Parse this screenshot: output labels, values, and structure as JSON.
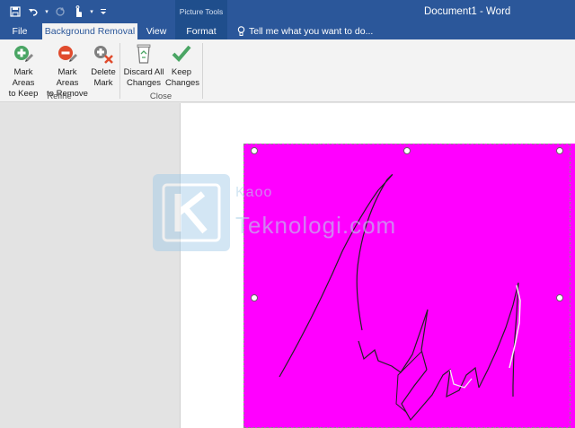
{
  "titlebar": {
    "doc_title": "Document1 - Word",
    "context_group": "Picture Tools"
  },
  "tabs": {
    "file": "File",
    "background_removal": "Background Removal",
    "view": "View",
    "format": "Format",
    "tell_me": "Tell me what you want to do..."
  },
  "ribbon": {
    "mark_keep_line1": "Mark Areas",
    "mark_keep_line2": "to Keep",
    "mark_remove_line1": "Mark Areas",
    "mark_remove_line2": "to Remove",
    "delete_mark_line1": "Delete",
    "delete_mark_line2": "Mark",
    "refine_group": "Refine",
    "discard_line1": "Discard All",
    "discard_line2": "Changes",
    "keep_line1": "Keep",
    "keep_line2": "Changes",
    "close_group": "Close"
  },
  "watermark": {
    "line1": "Kaoo",
    "line2": "Teknologi.com"
  },
  "colors": {
    "title_blue": "#2b579a",
    "removal_magenta": "#ff00ff",
    "keep_green": "#4aa564",
    "remove_red": "#e04b2d"
  }
}
